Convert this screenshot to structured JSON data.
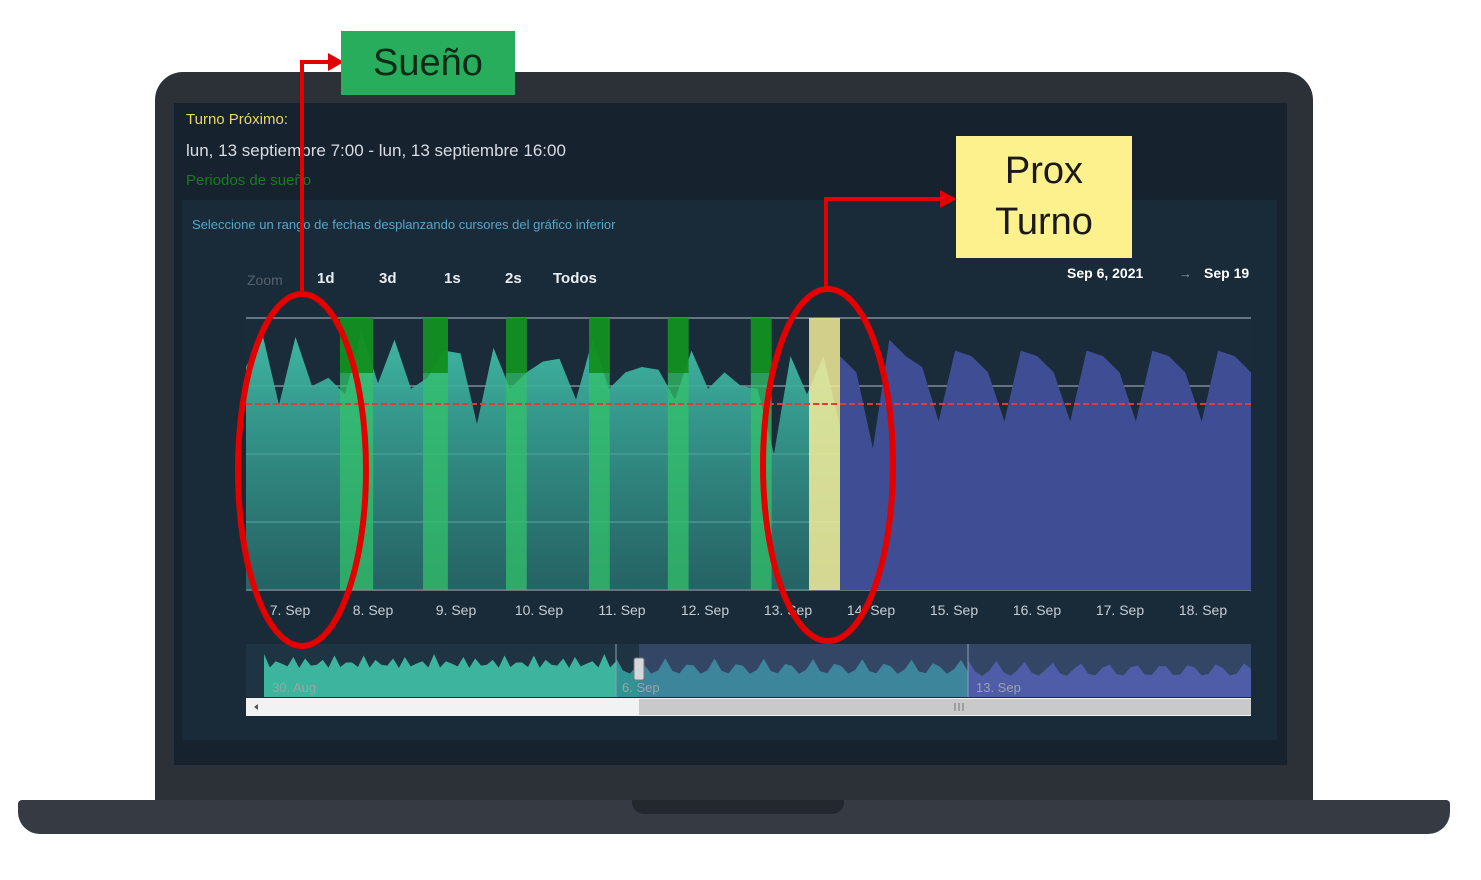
{
  "screen": {
    "turno_title": "Turno Próximo:",
    "turno_range": "lun, 13 septiembre 7:00 - lun, 13 septiembre 16:00",
    "sleep_periods_label": "Periodos de sueño",
    "hint": "Seleccione un rango de fechas desplanzando cursores del gráfico inferior",
    "zoom": {
      "label": "Zoom",
      "buttons": [
        "1d",
        "3d",
        "1s",
        "2s",
        "Todos"
      ]
    },
    "range": {
      "from": "Sep 6, 2021",
      "separator": "→",
      "to": "Sep 19"
    }
  },
  "chart_data": {
    "type": "area",
    "categories": [
      "7. Sep",
      "8. Sep",
      "9. Sep",
      "10. Sep",
      "11. Sep",
      "12. Sep",
      "13. Sep",
      "14. Sep",
      "15. Sep",
      "16. Sep",
      "17. Sep",
      "18. Sep"
    ],
    "series": [
      {
        "values": [
          0.82,
          0.94,
          0.68,
          0.93,
          0.75,
          0.78,
          0.72,
          0.95,
          0.76,
          0.92,
          0.74,
          0.78,
          0.88,
          0.87,
          0.61,
          0.89,
          0.74,
          0.8,
          0.84,
          0.85,
          0.7,
          0.92,
          0.74,
          0.8,
          0.82,
          0.81,
          0.7,
          0.88,
          0.74,
          0.8,
          0.75,
          0.74,
          0.5,
          0.86,
          0.72,
          0.86,
          0.6
        ]
      },
      {
        "values": [
          0.86,
          0.8,
          0.52,
          0.92,
          0.86,
          0.82,
          0.62,
          0.88,
          0.86,
          0.8,
          0.62,
          0.88,
          0.86,
          0.8,
          0.62,
          0.88,
          0.86,
          0.8,
          0.62,
          0.88,
          0.86,
          0.8,
          0.62,
          0.88,
          0.86,
          0.8
        ]
      }
    ],
    "threshold": 0.68,
    "ylim": [
      0,
      1
    ],
    "sleep_periods": [
      [
        0.55,
        0.95
      ],
      [
        1.55,
        1.85
      ],
      [
        2.55,
        2.8
      ],
      [
        3.55,
        3.8
      ],
      [
        4.5,
        4.75
      ],
      [
        5.5,
        5.75
      ]
    ],
    "next_shift": [
      6.8,
      7.2
    ],
    "colors": {
      "past_area": "#2f8f86",
      "future_area": "#3e4d94",
      "sleep": "#0e8a18",
      "sleep_light": "#33c26a",
      "shift": "#f3ec9a",
      "threshold": "#e23a3a"
    },
    "navigator": {
      "labels": [
        "30. Aug",
        "6. Sep",
        "13. Sep"
      ]
    }
  },
  "annotations": {
    "sleep_label": "Sueño",
    "shift_label_line1": "Prox",
    "shift_label_line2": "Turno",
    "color_ring": "#e50000"
  }
}
